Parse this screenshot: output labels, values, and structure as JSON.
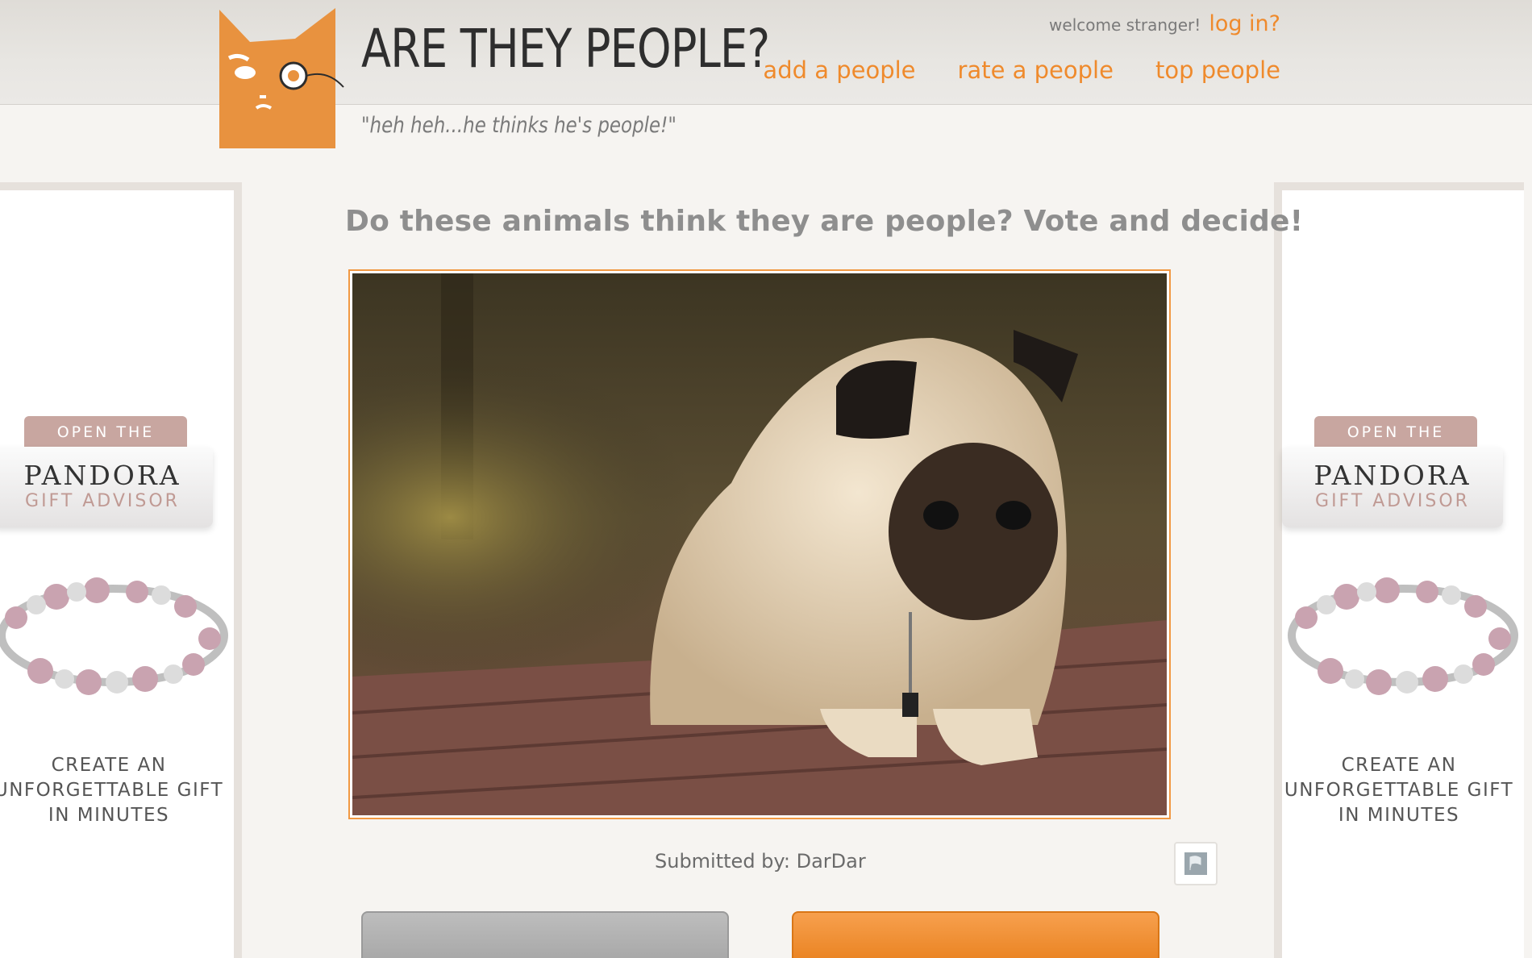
{
  "header": {
    "site_title": "ARE THEY PEOPLE?",
    "tagline": "\"heh heh...he thinks he's people!\"",
    "welcome_text": "welcome stranger!",
    "login_label": "log in?",
    "nav": [
      {
        "label": "add a people"
      },
      {
        "label": "rate a people"
      },
      {
        "label": "top people"
      }
    ]
  },
  "main": {
    "headline": "Do these animals think they are people? Vote and decide!",
    "submitted_by": "Submitted by: DarDar",
    "image_subject": "pug lying on a wooden deck"
  },
  "ads": {
    "tab_text": "OPEN THE",
    "brand": "PANDORA",
    "sub": "GIFT ADVISOR",
    "copy_line1": "CREATE AN",
    "copy_line2": "UNFORGETTABLE GIFT",
    "copy_line3": "IN MINUTES"
  },
  "colors": {
    "accent": "#ef8a2c",
    "logo_orange": "#e8923f",
    "headline_gray": "#8e8e8e"
  },
  "icons": [
    "cat-logo-icon",
    "flag-icon",
    "bracelet-image"
  ]
}
